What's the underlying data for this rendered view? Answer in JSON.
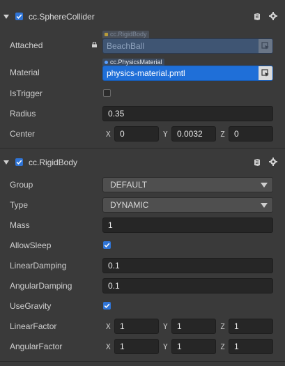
{
  "sphere_collider": {
    "title": "cc.SphereCollider",
    "props": {
      "attached": {
        "label": "Attached",
        "tag": "cc.RigidBody",
        "value": "BeachBall"
      },
      "material": {
        "label": "Material",
        "tag": "cc.PhysicsMaterial",
        "value": "physics-material.pmtl"
      },
      "is_trigger": {
        "label": "IsTrigger",
        "checked": false
      },
      "radius": {
        "label": "Radius",
        "value": "0.35"
      },
      "center": {
        "label": "Center",
        "x_label": "X",
        "x": "0",
        "y_label": "Y",
        "y": "0.0032",
        "z_label": "Z",
        "z": "0"
      }
    }
  },
  "rigid_body": {
    "title": "cc.RigidBody",
    "props": {
      "group": {
        "label": "Group",
        "value": "DEFAULT"
      },
      "type": {
        "label": "Type",
        "value": "DYNAMIC"
      },
      "mass": {
        "label": "Mass",
        "value": "1"
      },
      "allow_sleep": {
        "label": "AllowSleep",
        "checked": true
      },
      "linear_damping": {
        "label": "LinearDamping",
        "value": "0.1"
      },
      "angular_damping": {
        "label": "AngularDamping",
        "value": "0.1"
      },
      "use_gravity": {
        "label": "UseGravity",
        "checked": true
      },
      "linear_factor": {
        "label": "LinearFactor",
        "x_label": "X",
        "x": "1",
        "y_label": "Y",
        "y": "1",
        "z_label": "Z",
        "z": "1"
      },
      "angular_factor": {
        "label": "AngularFactor",
        "x_label": "X",
        "x": "1",
        "y_label": "Y",
        "y": "1",
        "z_label": "Z",
        "z": "1"
      }
    }
  },
  "colors": {
    "background": "#3a3a3a",
    "accent": "#2f74d6",
    "field_bg": "#262626"
  },
  "icons": {
    "collapse": "triangle-down-icon",
    "help": "book-icon",
    "settings": "gear-icon",
    "lock": "lock-icon",
    "pick": "asset-pick-icon"
  }
}
